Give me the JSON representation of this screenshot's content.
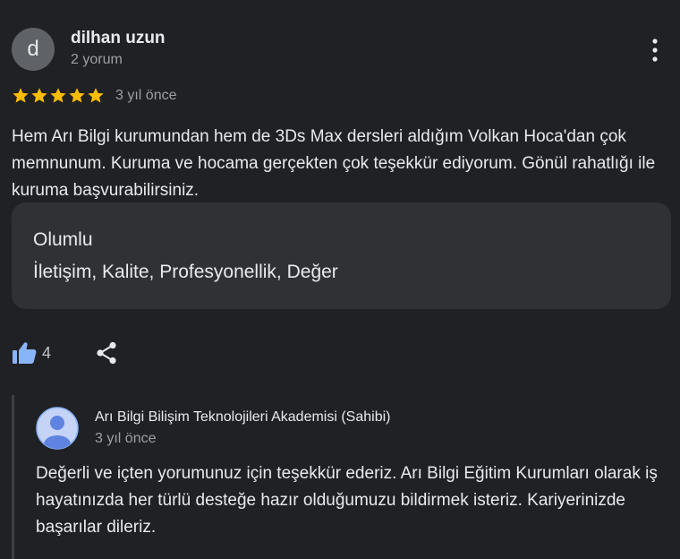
{
  "review": {
    "avatar_letter": "d",
    "author": "dilhan uzun",
    "author_meta": "2 yorum",
    "rating": 5,
    "date": "3 yıl önce",
    "text": "Hem Arı Bilgi kurumundan hem de 3Ds Max dersleri aldığım Volkan Hoca'dan çok memnunum. Kuruma ve hocama gerçekten çok teşekkür ediyorum. Gönül rahatlığı ile kuruma başvurabilirsiniz.",
    "attributes": {
      "label": "Olumlu",
      "values": "İletişim, Kalite, Profesyonellik, Değer"
    },
    "likes": "4"
  },
  "owner_reply": {
    "name": "Arı Bilgi Bilişim Teknolojileri Akademisi (Sahibi)",
    "date": "3 yıl önce",
    "text": "Değerli ve içten yorumunuz için teşekkür ederiz. Arı Bilgi Eğitim Kurumları olarak iş hayatınızda her türlü desteğe hazır olduğumuzu bildirmek isteriz. Kariyerinizde başarılar dileriz."
  },
  "icons": {
    "more": "more-vert-icon",
    "star": "star-icon",
    "like": "thumb-up-icon",
    "share": "share-icon",
    "owner_avatar": "person-avatar-icon"
  },
  "colors": {
    "background": "#202124",
    "star": "#fbbc04",
    "like": "#8ab4f8",
    "card": "#303134"
  }
}
